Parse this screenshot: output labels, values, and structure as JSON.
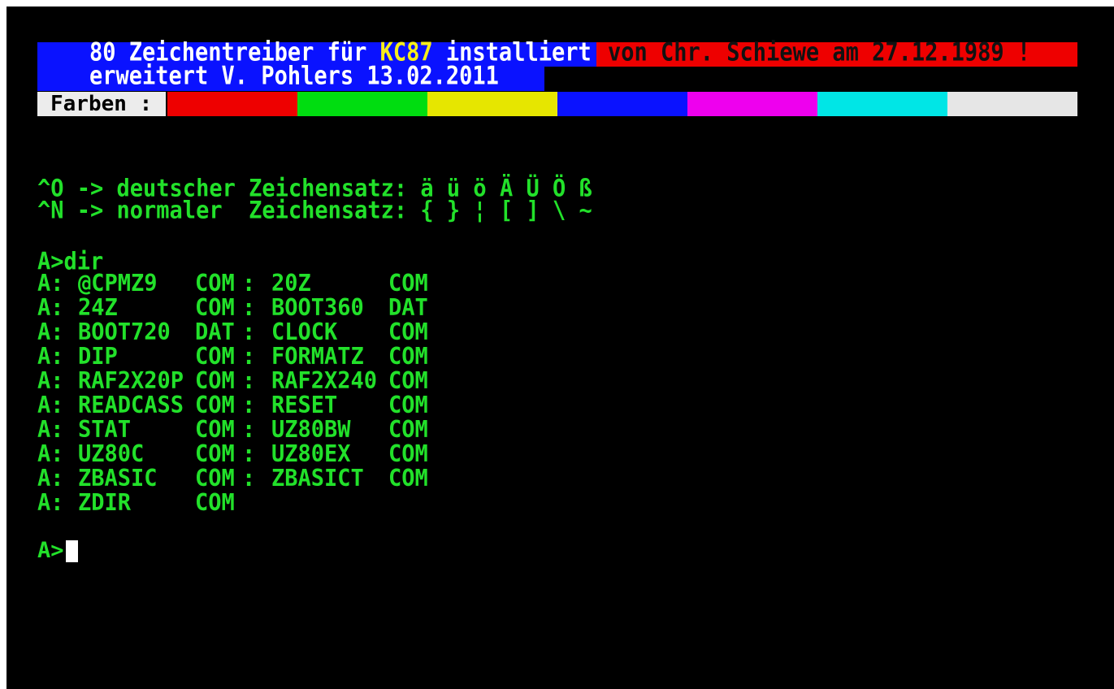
{
  "banner": {
    "line1_prefix": "80 Zeichentreiber für ",
    "line1_highlight": "KC87",
    "line1_suffix": " installiert",
    "line1_red": "von Chr. Schiewe am 27.12.1989 !",
    "line2": "erweitert V. Pohlers 13.02.2011"
  },
  "colors_bar": {
    "label": "Farben :",
    "swatches": [
      "#ee0000",
      "#00dd10",
      "#e6e600",
      "#0a12ff",
      "#ee00ee",
      "#00e6e6",
      "#e6e6e6"
    ]
  },
  "charset": {
    "line1": "^O -> deutscher Zeichensatz: ä ü ö Ä Ü Ö ß",
    "line2": "^N -> normaler  Zeichensatz: { } ¦ [ ] \\ ~"
  },
  "command": "A>dir",
  "dir": [
    {
      "drive": "A:",
      "name1": "@CPMZ9",
      "ext1": "COM",
      "sep": ":",
      "name2": "20Z",
      "ext2": "COM"
    },
    {
      "drive": "A:",
      "name1": "24Z",
      "ext1": "COM",
      "sep": ":",
      "name2": "BOOT360",
      "ext2": "DAT"
    },
    {
      "drive": "A:",
      "name1": "BOOT720",
      "ext1": "DAT",
      "sep": ":",
      "name2": "CLOCK",
      "ext2": "COM"
    },
    {
      "drive": "A:",
      "name1": "DIP",
      "ext1": "COM",
      "sep": ":",
      "name2": "FORMATZ",
      "ext2": "COM"
    },
    {
      "drive": "A:",
      "name1": "RAF2X20P",
      "ext1": "COM",
      "sep": ":",
      "name2": "RAF2X240",
      "ext2": "COM"
    },
    {
      "drive": "A:",
      "name1": "READCASS",
      "ext1": "COM",
      "sep": ":",
      "name2": "RESET",
      "ext2": "COM"
    },
    {
      "drive": "A:",
      "name1": "STAT",
      "ext1": "COM",
      "sep": ":",
      "name2": "UZ80BW",
      "ext2": "COM"
    },
    {
      "drive": "A:",
      "name1": "UZ80C",
      "ext1": "COM",
      "sep": ":",
      "name2": "UZ80EX",
      "ext2": "COM"
    },
    {
      "drive": "A:",
      "name1": "ZBASIC",
      "ext1": "COM",
      "sep": ":",
      "name2": "ZBASICT",
      "ext2": "COM"
    },
    {
      "drive": "A:",
      "name1": "ZDIR",
      "ext1": "COM",
      "sep": "",
      "name2": "",
      "ext2": ""
    }
  ],
  "prompt": "A>"
}
